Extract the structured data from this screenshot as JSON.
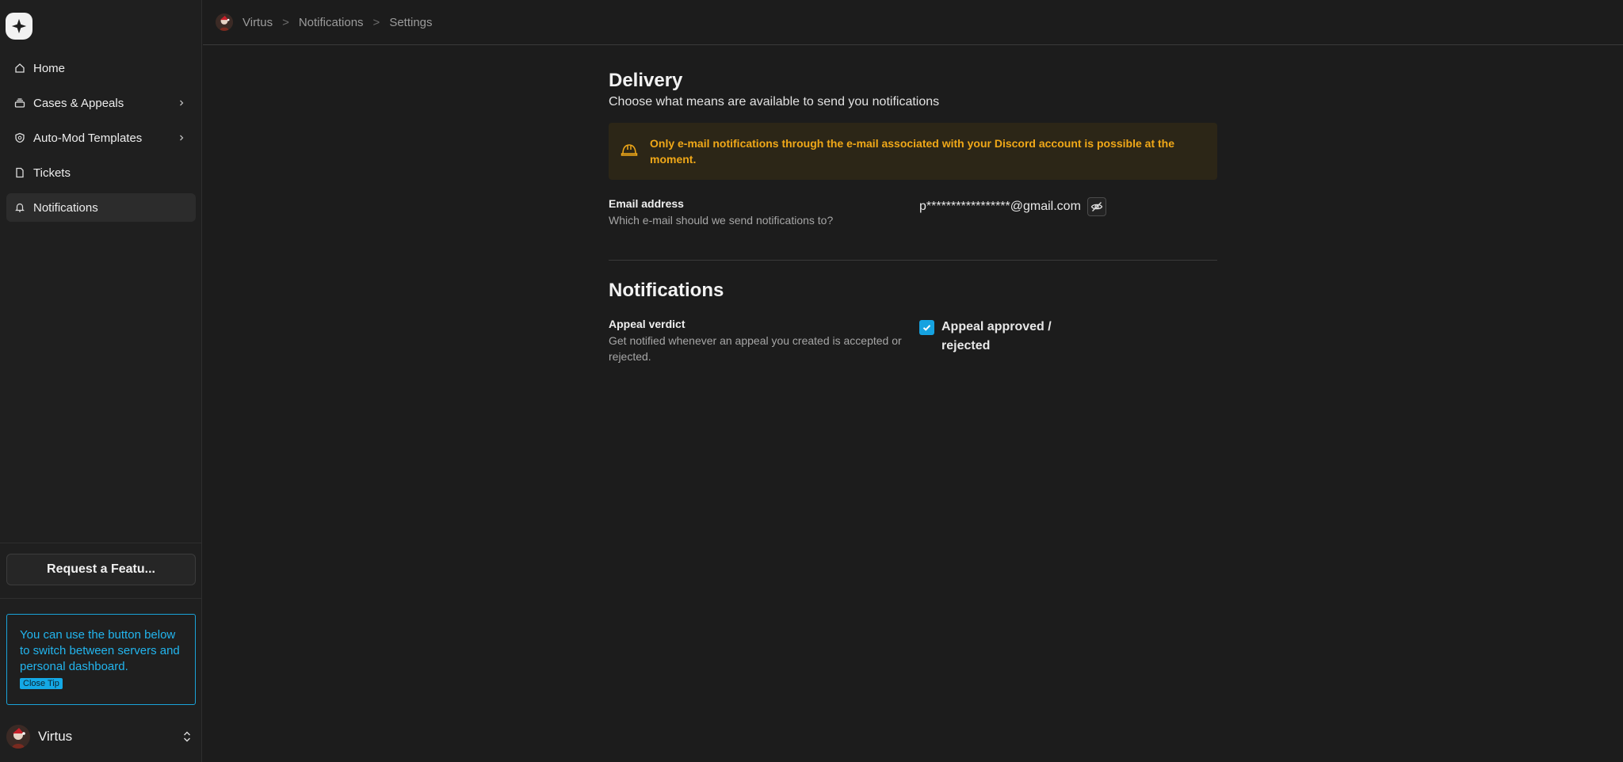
{
  "sidebar": {
    "items": [
      {
        "label": "Home",
        "icon": "home-icon"
      },
      {
        "label": "Cases & Appeals",
        "icon": "layers-icon"
      },
      {
        "label": "Auto-Mod Templates",
        "icon": "shield-icon"
      },
      {
        "label": "Tickets",
        "icon": "file-icon"
      },
      {
        "label": "Notifications",
        "icon": "bell-icon"
      }
    ],
    "feature_button": "Request a Featu...",
    "tip": {
      "text": "You can use the button below to switch between servers and personal dashboard.",
      "close_label": "Close Tip"
    },
    "server_name": "Virtus"
  },
  "header": {
    "breadcrumbs": [
      "Virtus",
      "Notifications",
      "Settings"
    ]
  },
  "delivery": {
    "title": "Delivery",
    "subtitle": "Choose what means are available to send you notifications",
    "warning": "Only e-mail notifications through the e-mail associated with your Discord account is possible at the moment.",
    "email_label": "Email address",
    "email_desc": "Which e-mail should we send notifications to?",
    "email_value": "p*****************@gmail.com"
  },
  "notifications": {
    "title": "Notifications",
    "appeal_label": "Appeal verdict",
    "appeal_desc": "Get notified whenever an appeal you created is accepted or rejected.",
    "appeal_option": "Appeal approved / rejected",
    "appeal_checked": true
  },
  "colors": {
    "accent": "#15a2e0",
    "warning": "#f0a818",
    "background": "#1c1c1c"
  }
}
